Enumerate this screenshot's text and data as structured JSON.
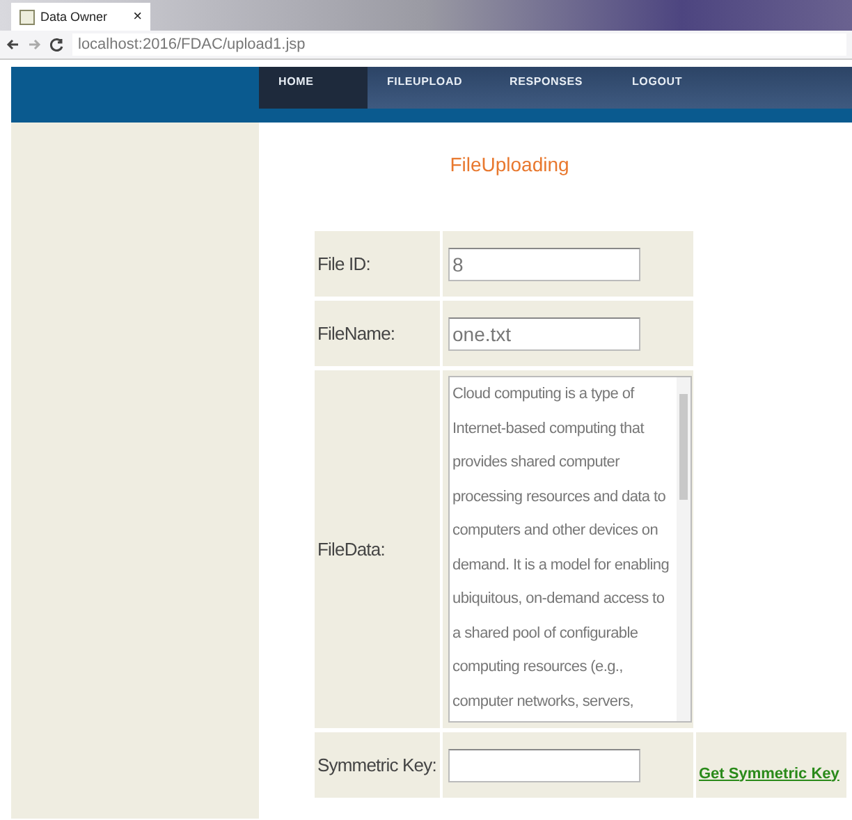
{
  "browser": {
    "tab_title": "Data Owner",
    "tab_close": "×",
    "address": "localhost:2016/FDAC/upload1.jsp"
  },
  "nav": [
    {
      "label": "HOME",
      "selected": true
    },
    {
      "label": "FILEUPLOAD",
      "selected": false
    },
    {
      "label": "RESPONSES",
      "selected": false
    },
    {
      "label": "LOGOUT",
      "selected": false
    }
  ],
  "heading": "FileUploading",
  "form": [
    {
      "kind": "input",
      "label": "File ID:",
      "value": "8"
    },
    {
      "kind": "textinput",
      "label": "FileName:",
      "value": "one.txt"
    },
    {
      "kind": "textarea",
      "label": "FileData:",
      "lines": [
        "Cloud computing is a type of",
        "Internet-based computing that",
        "provides shared computer",
        "processing resources and data to",
        "computers and other devices on",
        "demand. It is a model for enabling",
        "ubiquitous, on-demand access to",
        "a shared pool of configurable",
        "computing resources (e.g.,",
        "computer networks, servers,"
      ]
    },
    {
      "kind": "input",
      "label": "Symmetric Key:",
      "link": "Get Symmetric Key"
    }
  ]
}
